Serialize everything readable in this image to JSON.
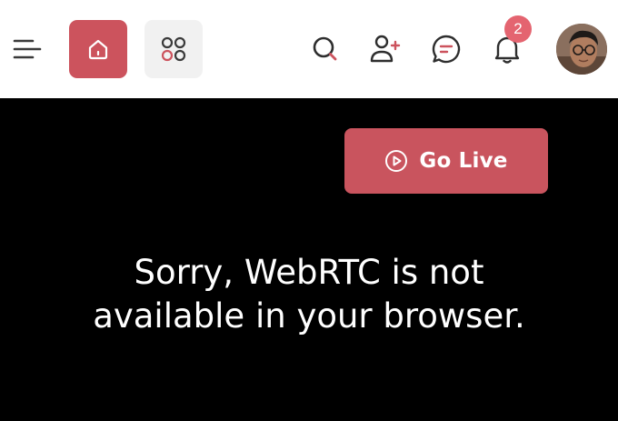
{
  "header": {
    "icons": {
      "menu": "menu-icon",
      "home": "home-icon",
      "apps": "apps-grid-icon",
      "search": "search-icon",
      "add_user": "add-user-icon",
      "chat": "chat-icon",
      "bell": "bell-icon"
    },
    "notification_count": "2",
    "active_color": "#cc535d",
    "badge_color": "#e46470"
  },
  "live": {
    "button_label": "Go Live",
    "button_color": "#c9545e",
    "icon": "play-circle-icon"
  },
  "message": {
    "line1": "Sorry, WebRTC is not",
    "line2": "available in your browser."
  }
}
